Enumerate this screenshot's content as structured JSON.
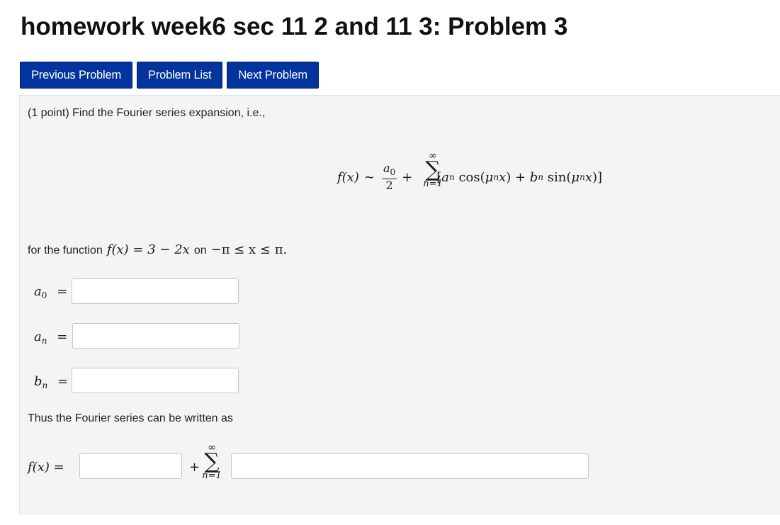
{
  "page": {
    "title": "homework week6 sec 11 2 and 11 3: Problem 3"
  },
  "nav": {
    "previous_label": "Previous Problem",
    "list_label": "Problem List",
    "next_label": "Next Problem"
  },
  "problem": {
    "intro": "(1 point) Find the Fourier series expansion, i.e.,",
    "formula": {
      "lhs": "f(x)",
      "sim": "∼",
      "frac_num": "a",
      "frac_num_sub": "0",
      "frac_den": "2",
      "plus": "+",
      "sum_top": "∞",
      "sum_symbol": "∑",
      "sum_bottom": "n=1",
      "bracket_open": "[",
      "a_n": "a",
      "a_n_sub": "n",
      "cos": " cos(",
      "mu": "μ",
      "mu_sub": "n",
      "x": "x",
      "close_plus": ") + ",
      "b_n": "b",
      "b_n_sub": "n",
      "sin": " sin(",
      "bracket_close": ")]"
    },
    "function_prefix": "for the function",
    "function_expr": "f(x) = 3 − 2x",
    "function_on": "on",
    "function_domain": "−π ≤ x ≤ π.",
    "coefficients": [
      {
        "symbol": "a",
        "sub": "0",
        "eq": "=",
        "value": ""
      },
      {
        "symbol": "a",
        "sub": "n",
        "eq": "=",
        "value": ""
      },
      {
        "symbol": "b",
        "sub": "n",
        "eq": "=",
        "value": ""
      }
    ],
    "thus_text": "Thus the Fourier series can be written as",
    "series": {
      "lhs": "f(x) =",
      "plus": "+",
      "sum_top": "∞",
      "sum_symbol": "∑",
      "sum_bottom": "n=1",
      "const_value": "",
      "term_value": ""
    }
  }
}
